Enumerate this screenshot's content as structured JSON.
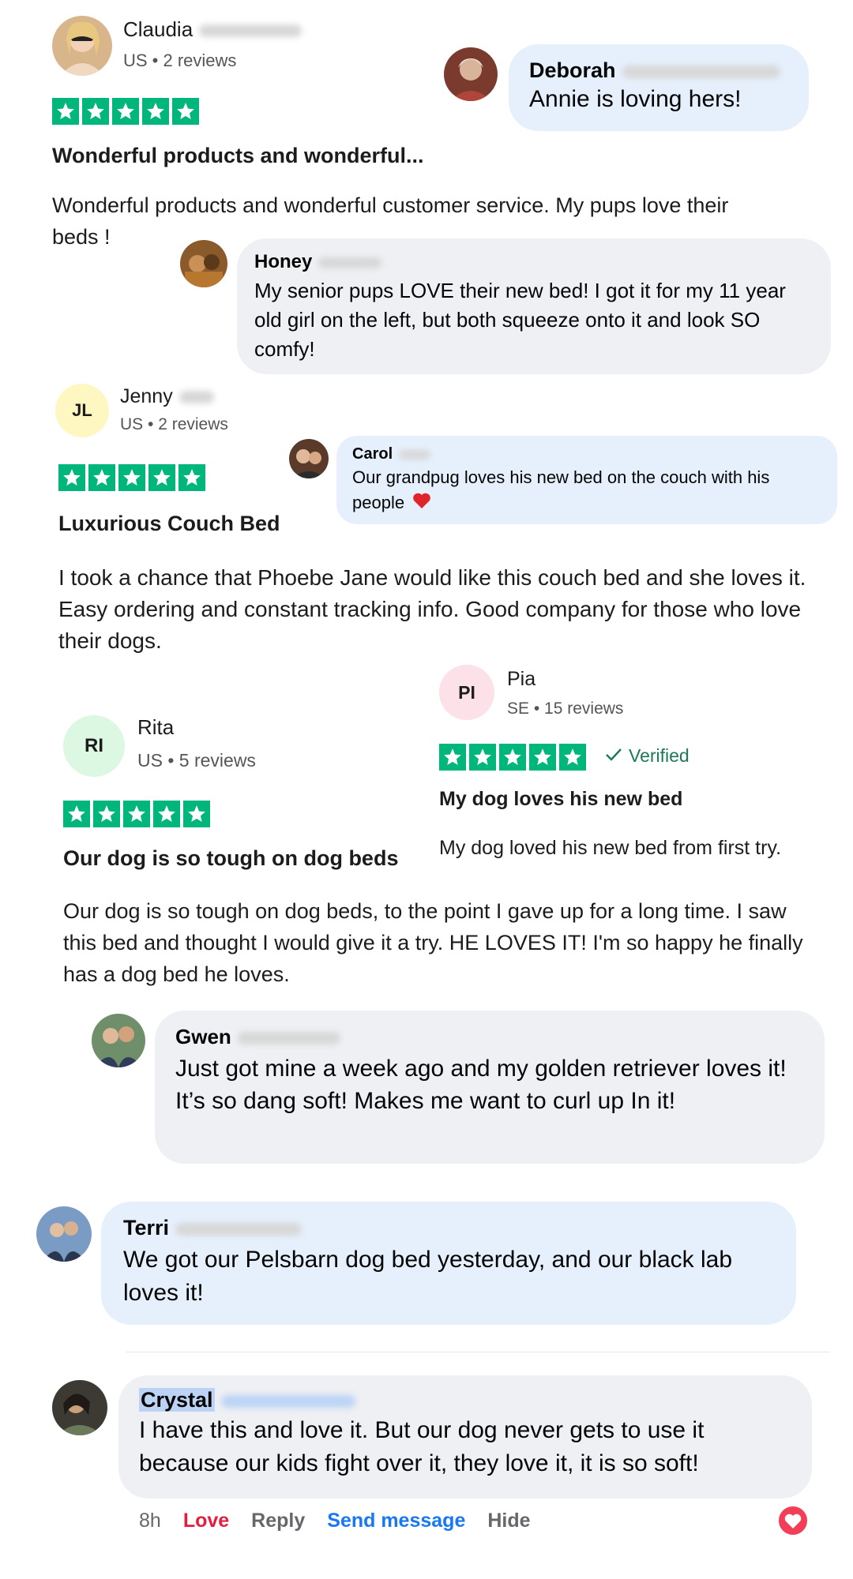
{
  "reviews": {
    "claudia": {
      "name": "Claudia",
      "meta": "US • 2 reviews",
      "title": "Wonderful products and wonderful...",
      "body": "Wonderful products and wonderful customer service. My pups love their beds !"
    },
    "jenny": {
      "initials": "JL",
      "name": "Jenny",
      "meta": "US • 2 reviews",
      "title": "Luxurious Couch Bed",
      "body": "I took a chance that Phoebe Jane would like this couch bed and she loves it. Easy ordering and constant tracking info. Good company for those who love their dogs."
    },
    "pia": {
      "initials": "PI",
      "name": "Pia",
      "meta": "SE • 15 reviews",
      "verified": "Verified",
      "title": "My dog loves his new bed",
      "body": "My dog loved his new bed from first try."
    },
    "rita": {
      "initials": "RI",
      "name": "Rita",
      "meta": "US • 5 reviews",
      "title": "Our dog is so tough on dog beds",
      "body": "Our dog is so tough on dog beds, to the point I gave up for a long time. I saw this bed and thought I would give it a try. HE LOVES IT! I'm so happy he finally has a dog bed he loves."
    }
  },
  "comments": {
    "deborah": {
      "name": "Deborah",
      "text": "Annie is loving hers!"
    },
    "honey": {
      "name": "Honey",
      "text": "My senior pups LOVE their new bed! I got it for my 11 year old girl on the left, but both squeeze onto it and look SO comfy!"
    },
    "carol": {
      "name": "Carol",
      "text": "Our grandpug loves his new bed on the couch with his people"
    },
    "gwen": {
      "name": "Gwen",
      "text": "Just got mine a week ago and my golden retriever loves it! It’s so dang soft! Makes me want to curl up In it!"
    },
    "terri": {
      "name": "Terri",
      "text": "We got our Pelsbarn dog bed yesterday, and our black lab loves it!"
    },
    "crystal": {
      "name": "Crystal",
      "text": "I have this and love it. But our dog never gets to use it because our kids fight over it, they love it, it is so soft!"
    }
  },
  "footer": {
    "time": "8h",
    "love": "Love",
    "reply": "Reply",
    "send": "Send message",
    "hide": "Hide"
  },
  "icons": {
    "star": "star-icon",
    "heart": "heart-icon",
    "check": "check-icon",
    "reaction": "love-reaction-icon"
  },
  "colors": {
    "trustpilot_green": "#00b67a",
    "love_red": "#e41e3f",
    "messenger_blue": "#1877f2",
    "verified_green": "#1c7a55"
  }
}
